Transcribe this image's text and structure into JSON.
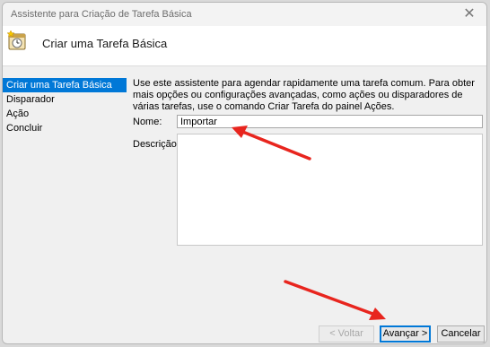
{
  "window": {
    "title": "Assistente para Criação de Tarefa Básica",
    "close_glyph": "✕"
  },
  "header": {
    "heading": "Criar uma Tarefa Básica",
    "icon": "task-scheduler-icon"
  },
  "sidebar": {
    "items": [
      {
        "label": "Criar uma Tarefa Básica",
        "active": true
      },
      {
        "label": "Disparador",
        "active": false
      },
      {
        "label": "Ação",
        "active": false
      },
      {
        "label": "Concluir",
        "active": false
      }
    ]
  },
  "main": {
    "description": "Use este assistente para agendar rapidamente uma tarefa comum. Para obter mais opções ou configurações avançadas, como ações ou disparadores de várias tarefas, use o comando Criar Tarefa do painel Ações.",
    "name_label": "Nome:",
    "name_value": "Importar",
    "description_label": "Descrição:",
    "description_value": ""
  },
  "buttons": {
    "back": "< Voltar",
    "next": "Avançar >",
    "cancel": "Cancelar"
  },
  "colors": {
    "accent": "#0078d7",
    "annotation_arrow": "#e8251e"
  }
}
